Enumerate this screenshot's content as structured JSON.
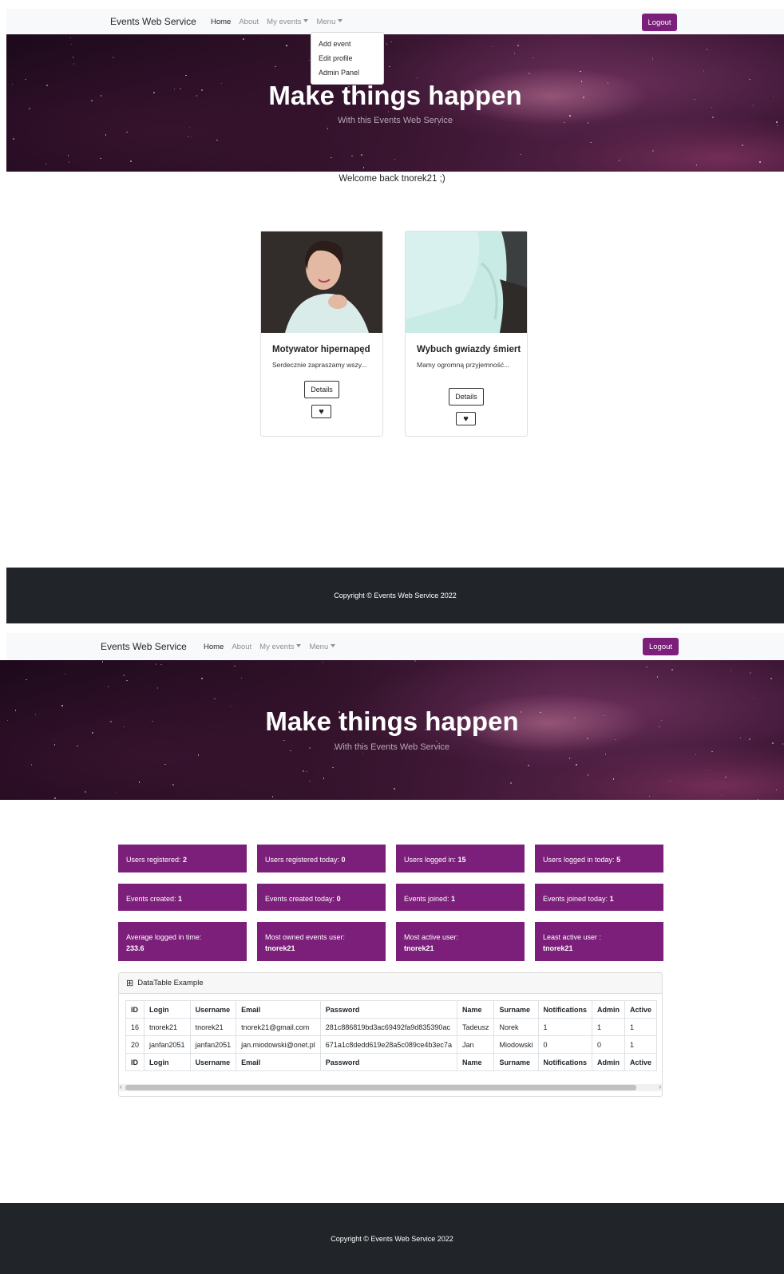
{
  "app": {
    "brand": "Events Web Service",
    "nav": {
      "home": "Home",
      "about": "About",
      "my_events": "My events",
      "menu": "Menu"
    },
    "logout_label": "Logout",
    "hero_title": "Make things happen",
    "hero_subtitle": "With this Events Web Service",
    "footer_text": "Copyright © Events Web Service 2022",
    "accent_color": "#7b1f7a"
  },
  "dropdown": {
    "items": [
      "Add event",
      "Edit profile",
      "Admin Panel"
    ]
  },
  "home": {
    "welcome": "Welcome back tnorek21 ;)",
    "events": [
      {
        "title": "Motywator hipernapęd",
        "text": "Serdecznie zapraszamy wszy...",
        "details_label": "Details"
      },
      {
        "title": "Wybuch gwiazdy śmiertelnej",
        "text": "Mamy ogromną przyjemność...",
        "details_label": "Details"
      }
    ]
  },
  "admin": {
    "stats": [
      {
        "label": "Users registered:",
        "value": "2"
      },
      {
        "label": "Users registered today:",
        "value": "0"
      },
      {
        "label": "Users logged in:",
        "value": "15"
      },
      {
        "label": "Users logged in today:",
        "value": "5"
      },
      {
        "label": "Events created:",
        "value": "1"
      },
      {
        "label": "Events created today:",
        "value": "0"
      },
      {
        "label": "Events joined:",
        "value": "1"
      },
      {
        "label": "Events joined today:",
        "value": "1"
      },
      {
        "label": "Average logged in time:",
        "value": "233.6"
      },
      {
        "label": "Most owned events user:",
        "value": "tnorek21"
      },
      {
        "label": "Most active user:",
        "value": "tnorek21"
      },
      {
        "label": "Least active user :",
        "value": "tnorek21"
      }
    ],
    "table": {
      "title": "DataTable Example",
      "columns": [
        "ID",
        "Login",
        "Username",
        "Email",
        "Password",
        "Name",
        "Surname",
        "Notifications",
        "Admin",
        "Active"
      ],
      "rows": [
        [
          "16",
          "tnorek21",
          "tnorek21",
          "tnorek21@gmail.com",
          "281c886819bd3ac69492fa9d835390ac",
          "Tadeusz",
          "Norek",
          "1",
          "1",
          "1"
        ],
        [
          "20",
          "janfan2051",
          "janfan2051",
          "jan.miodowski@onet.pl",
          "671a1c8dedd619e28a5c089ce4b3ec7a",
          "Jan",
          "Miodowski",
          "0",
          "0",
          "1"
        ]
      ]
    }
  }
}
